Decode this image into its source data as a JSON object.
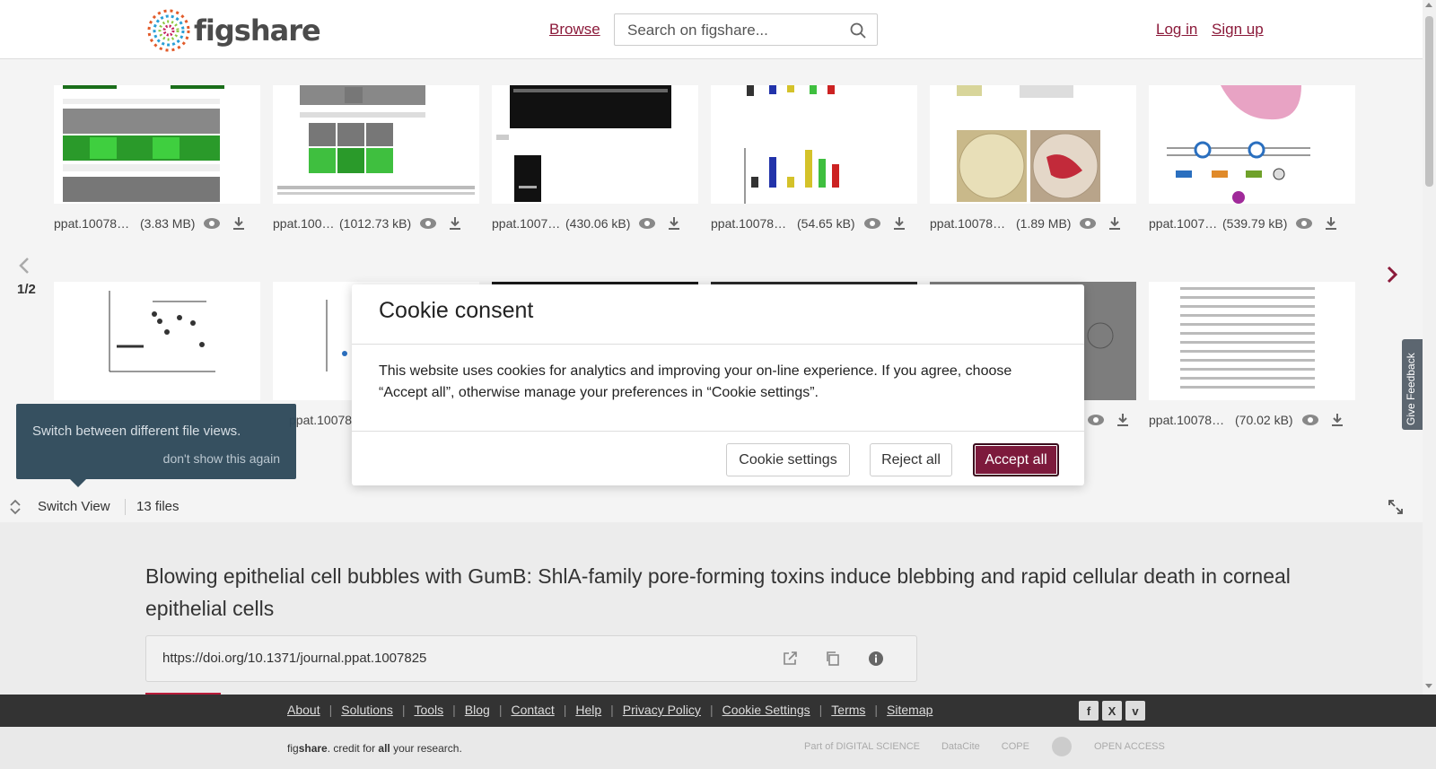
{
  "header": {
    "logo_text": "figshare",
    "browse_label": "Browse",
    "search_placeholder": "Search on figshare...",
    "login_label": "Log in",
    "signup_label": "Sign up"
  },
  "gallery": {
    "pager": "1/2",
    "row1": [
      {
        "name": "ppat.10078…",
        "size": "(3.83 MB)"
      },
      {
        "name": "ppat.100…",
        "size": "(1012.73 kB)"
      },
      {
        "name": "ppat.1007…",
        "size": "(430.06 kB)"
      },
      {
        "name": "ppat.10078…",
        "size": "(54.65 kB)"
      },
      {
        "name": "ppat.10078…",
        "size": "(1.89 MB)"
      },
      {
        "name": "ppat.1007…",
        "size": "(539.79 kB)"
      }
    ],
    "row2": [
      {
        "name": "",
        "size": ""
      },
      {
        "name": "ppat.10078…",
        "size": ""
      },
      {
        "name": "",
        "size": ""
      },
      {
        "name": "",
        "size": ""
      },
      {
        "name": "",
        "size": ""
      },
      {
        "name": "ppat.10078…",
        "size": "(70.02 kB)"
      }
    ],
    "tooltip_text": "Switch between different file views.",
    "tooltip_dismiss": "don't show this again",
    "switch_view_label": "Switch View",
    "files_count": "13 files"
  },
  "article": {
    "title": "Blowing epithelial cell bubbles with GumB: ShlA-family pore-forming toxins induce blebbing and rapid cellular death in corneal epithelial cells",
    "doi": "https://doi.org/10.1371/journal.ppat.1007825"
  },
  "feedback_label": "Give Feedback",
  "footer": {
    "links": [
      "About",
      "Solutions",
      "Tools",
      "Blog",
      "Contact",
      "Help",
      "Privacy Policy",
      "Cookie Settings",
      "Terms",
      "Sitemap"
    ],
    "tagline_pre": "fig",
    "tagline_bold": "share",
    "tagline_mid": ". credit for ",
    "tagline_all": "all",
    "tagline_end": " your research.",
    "partners": [
      "Part of DIGITAL SCIENCE",
      "DataCite",
      "COPE",
      "",
      "OPEN ACCESS"
    ]
  },
  "cookie_modal": {
    "title": "Cookie consent",
    "body": "This website uses cookies for analytics and improving your on-line experience. If you agree, choose “Accept all”, otherwise manage your preferences in “Cookie settings”.",
    "settings_label": "Cookie settings",
    "reject_label": "Reject all",
    "accept_label": "Accept all"
  },
  "colors": {
    "brand": "#8b1a3a",
    "accept_button": "#7d1a3c",
    "tooltip_bg": "#2f4a5b",
    "footer_bg": "#333333"
  }
}
